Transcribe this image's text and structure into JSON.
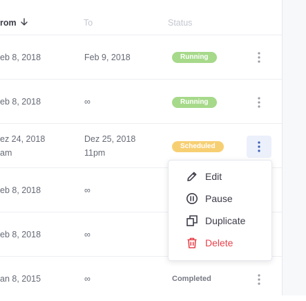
{
  "header": {
    "from": "rom",
    "to": "To",
    "status": "Status"
  },
  "rows": [
    {
      "from": "eb 8, 2018",
      "to": "Feb 9, 2018",
      "status": "Running",
      "status_kind": "running"
    },
    {
      "from": "eb 8, 2018",
      "to": "∞",
      "status": "Running",
      "status_kind": "running"
    },
    {
      "from": "ez 24, 2018",
      "from_time": "am",
      "to": "Dez 25, 2018",
      "to_time": "11pm",
      "status": "Scheduled",
      "status_kind": "scheduled"
    },
    {
      "from": "eb 8, 2018",
      "to": "∞"
    },
    {
      "from": "eb 8, 2018",
      "to": "∞"
    },
    {
      "from": "an 8, 2015",
      "to": "∞",
      "status": "Completed",
      "status_kind": "completed"
    }
  ],
  "menu": {
    "edit": "Edit",
    "pause": "Pause",
    "duplicate": "Duplicate",
    "delete": "Delete"
  },
  "colors": {
    "running": "#a6d98a",
    "scheduled": "#f7cf73",
    "danger": "#e7424a",
    "active_kebab": "#ebf0fb"
  }
}
